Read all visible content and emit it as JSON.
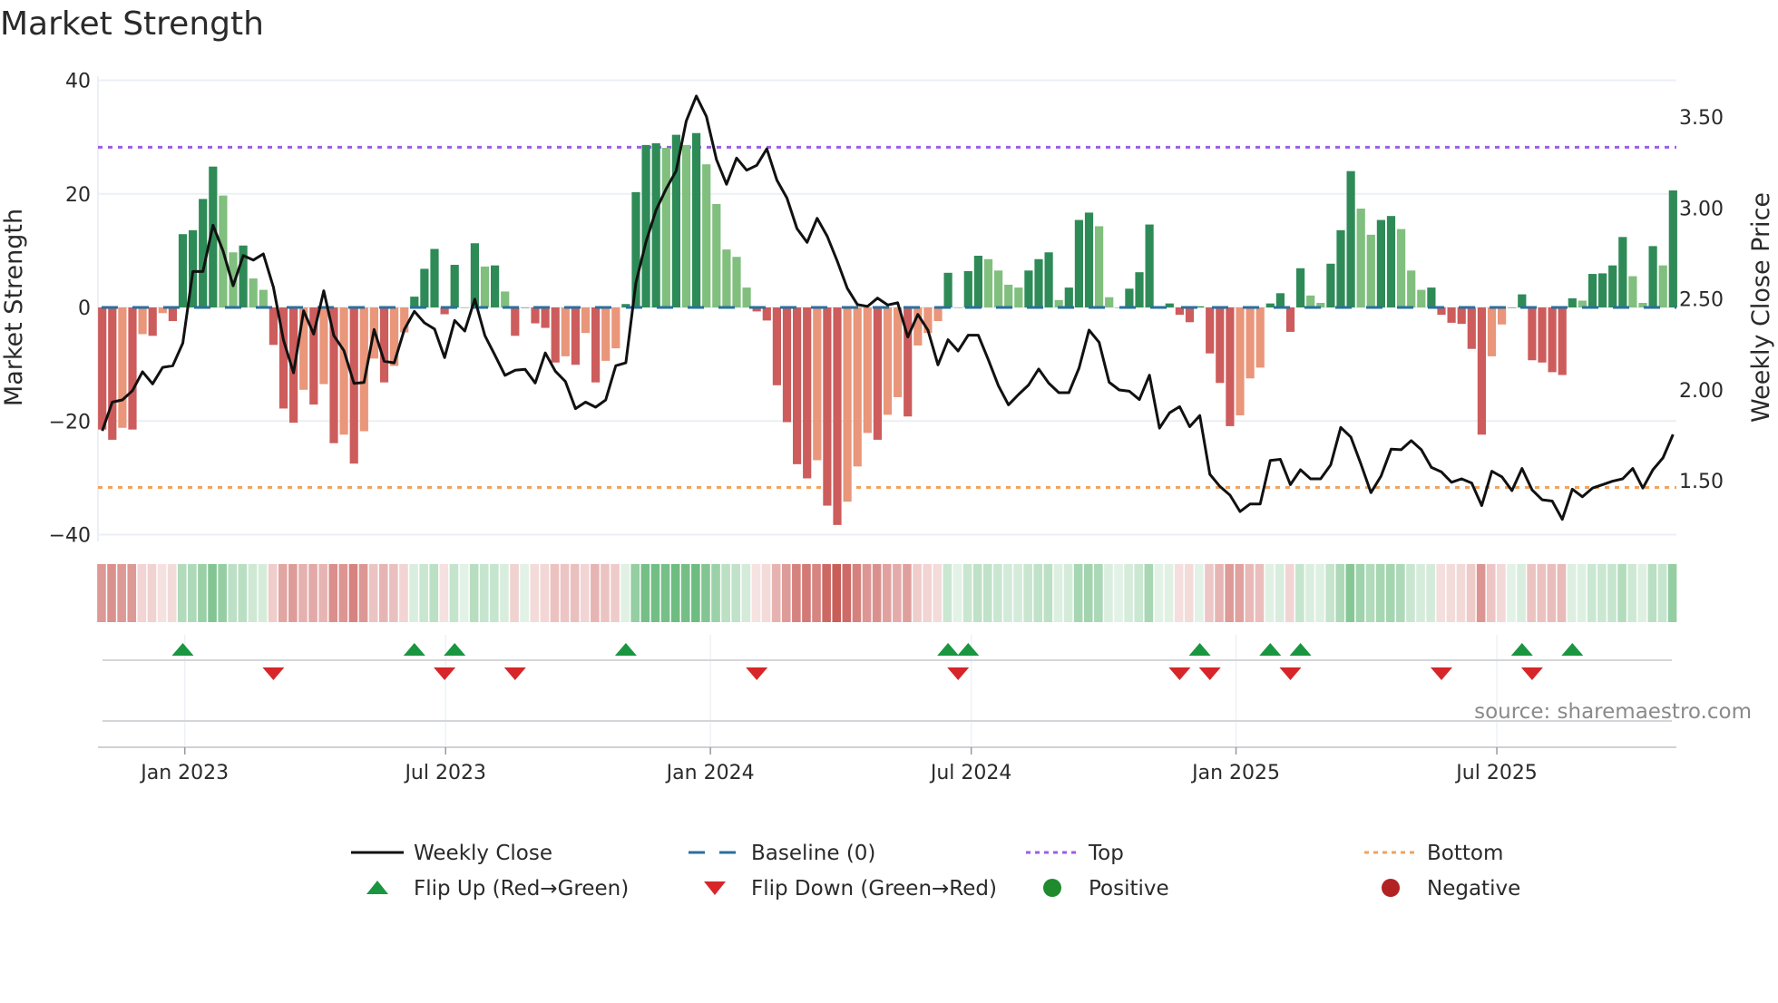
{
  "chart_data": {
    "type": "bar+line",
    "title": "Market Strength",
    "ylabel": "Market Strength",
    "y2label": "Weekly Close Price",
    "ylim": [
      -40,
      40
    ],
    "yticks": [
      {
        "v": 40,
        "label": "40"
      },
      {
        "v": 20,
        "label": "20"
      },
      {
        "v": 0,
        "label": "0"
      },
      {
        "v": -20,
        "label": "−20"
      },
      {
        "v": -40,
        "label": "−40"
      }
    ],
    "y2ticks": [
      {
        "v": 3.5,
        "label": "3.50"
      },
      {
        "v": 3.0,
        "label": "3.00"
      },
      {
        "v": 2.5,
        "label": "2.50"
      },
      {
        "v": 2.0,
        "label": "2.00"
      },
      {
        "v": 1.5,
        "label": "1.50"
      }
    ],
    "xticks": [
      {
        "week": 9.2,
        "label": "Jan 2023"
      },
      {
        "week": 35.1,
        "label": "Jul 2023"
      },
      {
        "week": 61.4,
        "label": "Jan 2024"
      },
      {
        "week": 87.3,
        "label": "Jul 2024"
      },
      {
        "week": 113.6,
        "label": "Jan 2025"
      },
      {
        "week": 139.5,
        "label": "Jul 2025"
      }
    ],
    "top": 28.2,
    "bottom": -31.7,
    "baseline": 0,
    "strength": [
      -21.5,
      -23.3,
      -21.2,
      -21.5,
      -4.7,
      -5,
      -1,
      -2.4,
      12.9,
      13.6,
      19.1,
      24.8,
      19.7,
      9.7,
      10.9,
      5.1,
      3.1,
      -6.6,
      -17.8,
      -20.3,
      -14.5,
      -17.1,
      -13.5,
      -23.9,
      -22.4,
      -27.5,
      -21.8,
      -9,
      -13.2,
      -10.3,
      -4.4,
      1.9,
      6.8,
      10.3,
      -1.2,
      7.5,
      0,
      11.3,
      7.2,
      7.4,
      2.8,
      -5,
      0,
      -2.8,
      -3.6,
      -9.7,
      -8.6,
      -10.1,
      -4.5,
      -13.2,
      -9.4,
      -7.2,
      0.6,
      20.3,
      28.6,
      28.9,
      28.1,
      30.4,
      28.6,
      30.7,
      25.2,
      18.2,
      10.2,
      8.9,
      3.5,
      -0.7,
      -2.3,
      -13.7,
      -20.2,
      -27.6,
      -30.1,
      -26.9,
      -34.9,
      -38.3,
      -34.2,
      -28,
      -22.1,
      -23.3,
      -18.9,
      -15.8,
      -19.2,
      -6.7,
      -4.5,
      -2.4,
      6.1,
      0,
      6.4,
      9.1,
      8.5,
      6.5,
      4,
      3.5,
      6.5,
      8.5,
      9.7,
      1.3,
      3.5,
      15.4,
      16.7,
      14.3,
      1.8,
      0,
      3.3,
      6.2,
      14.6,
      0,
      0.7,
      -1.3,
      -2.6,
      0.2,
      -8.1,
      -13.3,
      -20.9,
      -19,
      -12.5,
      -10.6,
      0.7,
      2.5,
      -4.3,
      6.9,
      2.1,
      0.8,
      7.7,
      13.6,
      24,
      17.4,
      12.8,
      15.4,
      16.1,
      13.8,
      6.5,
      3.1,
      3.5,
      -1.3,
      -2.7,
      -2.9,
      -7.3,
      -22.4,
      -8.6,
      -3,
      0,
      2.3,
      -9.3,
      -9.7,
      -11.4,
      -11.9,
      1.6,
      1.2,
      5.9,
      6,
      7.4,
      12.4,
      5.5,
      0.8,
      10.8,
      7.4,
      20.6
    ],
    "close": [
      1.774,
      1.932,
      1.944,
      1.995,
      2.099,
      2.032,
      2.123,
      2.132,
      2.256,
      2.65,
      2.65,
      2.905,
      2.763,
      2.572,
      2.738,
      2.713,
      2.747,
      2.564,
      2.273,
      2.093,
      2.434,
      2.306,
      2.544,
      2.298,
      2.215,
      2.035,
      2.04,
      2.331,
      2.157,
      2.148,
      2.331,
      2.431,
      2.368,
      2.334,
      2.177,
      2.381,
      2.323,
      2.498,
      2.298,
      2.19,
      2.079,
      2.107,
      2.112,
      2.037,
      2.202,
      2.102,
      2.045,
      1.896,
      1.932,
      1.904,
      1.944,
      2.132,
      2.148,
      2.589,
      2.813,
      2.988,
      3.104,
      3.204,
      3.478,
      3.615,
      3.503,
      3.266,
      3.13,
      3.274,
      3.207,
      3.234,
      3.325,
      3.153,
      3.054,
      2.886,
      2.81,
      2.943,
      2.844,
      2.707,
      2.557,
      2.468,
      2.458,
      2.504,
      2.466,
      2.478,
      2.29,
      2.414,
      2.328,
      2.137,
      2.275,
      2.213,
      2.3,
      2.3,
      2.165,
      2.022,
      1.917,
      1.974,
      2.026,
      2.114,
      2.036,
      1.984,
      1.984,
      2.118,
      2.328,
      2.261,
      2.041,
      1.999,
      1.992,
      1.946,
      2.08,
      1.789,
      1.873,
      1.907,
      1.797,
      1.858,
      1.535,
      1.468,
      1.42,
      1.33,
      1.372,
      1.372,
      1.611,
      1.617,
      1.478,
      1.56,
      1.51,
      1.51,
      1.587,
      1.793,
      1.74,
      1.592,
      1.434,
      1.525,
      1.673,
      1.67,
      1.72,
      1.67,
      1.573,
      1.548,
      1.491,
      1.51,
      1.487,
      1.363,
      1.552,
      1.521,
      1.445,
      1.567,
      1.449,
      1.395,
      1.388,
      1.287,
      1.453,
      1.411,
      1.459,
      1.478,
      1.497,
      1.51,
      1.567,
      1.459,
      1.56,
      1.625,
      1.754
    ],
    "flip_up_weeks": [
      9,
      32,
      36,
      53,
      85,
      87,
      110,
      117,
      120,
      142,
      147
    ],
    "flip_down_weeks": [
      18,
      35,
      42,
      66,
      86,
      108,
      111,
      119,
      134,
      143
    ],
    "colors": {
      "strong_positive": "#2e8b57",
      "weak_positive": "#80bf7e",
      "strong_negative": "#cd5c5c",
      "weak_negative": "#e9967a",
      "line": "#111111",
      "baseline": "#2a6f9e",
      "top": "#9b5de5",
      "bottom": "#f0a35e",
      "flip_up": "#1a9641",
      "flip_down": "#d7262a",
      "positive": "#1f8a2e",
      "negative": "#b22222"
    },
    "legend": [
      {
        "key": "line",
        "label": "Weekly Close"
      },
      {
        "key": "baseline",
        "label": "Baseline (0)"
      },
      {
        "key": "top",
        "label": "Top"
      },
      {
        "key": "bottom",
        "label": "Bottom"
      },
      {
        "key": "flip_up",
        "label": "Flip Up (Red→Green)"
      },
      {
        "key": "flip_down",
        "label": "Flip Down (Green→Red)"
      },
      {
        "key": "positive",
        "label": "Positive"
      },
      {
        "key": "negative",
        "label": "Negative"
      }
    ],
    "source": "source: sharemaestro.com"
  }
}
